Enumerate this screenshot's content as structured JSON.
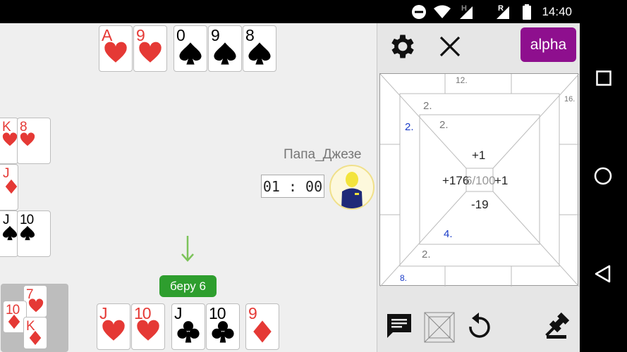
{
  "status_bar": {
    "time": "14:40",
    "icons": [
      "do-not-disturb-icon",
      "wifi-icon",
      "signal-h-icon",
      "signal-r-icon",
      "battery-icon"
    ]
  },
  "table": {
    "top_cards": [
      {
        "rank": "A",
        "suit": "hearts"
      },
      {
        "rank": "9",
        "suit": "hearts"
      },
      {
        "rank": "0",
        "suit": "spades"
      },
      {
        "rank": "9",
        "suit": "spades"
      },
      {
        "rank": "8",
        "suit": "spades"
      }
    ],
    "left_cards": [
      {
        "rank": "K",
        "suit": "hearts"
      },
      {
        "rank": "8",
        "suit": "hearts"
      },
      {
        "rank": "J",
        "suit": "diamonds"
      },
      {
        "rank": "J",
        "suit": "spades"
      },
      {
        "rank": "10",
        "suit": "spades"
      }
    ],
    "trick_cards": [
      {
        "rank": "7",
        "suit": "hearts"
      },
      {
        "rank": "10",
        "suit": "diamonds"
      },
      {
        "rank": "K",
        "suit": "diamonds"
      }
    ],
    "hand_cards": [
      {
        "rank": "J",
        "suit": "hearts"
      },
      {
        "rank": "10",
        "suit": "hearts"
      },
      {
        "rank": "J",
        "suit": "clubs"
      },
      {
        "rank": "10",
        "suit": "clubs"
      },
      {
        "rank": "9",
        "suit": "diamonds"
      }
    ],
    "player_name": "Папа_Джезе",
    "timer": "01 : 00",
    "bid_label": "беру 6",
    "colors": {
      "red_suit": "#e53935",
      "bid_green": "#2e9e2e",
      "arrow_green": "#7cc35a"
    }
  },
  "panel": {
    "alpha_label": "alpha",
    "alpha_color": "#8e0f8e",
    "score": {
      "top": "12.",
      "top_right": "16.",
      "outer_left_1": "2.",
      "outer_left_blue": "2.",
      "inner_top": "2.",
      "center_top": "+1",
      "center_left": "+176",
      "center_box": "6/100",
      "center_right": "+1",
      "center_bottom": "-19",
      "inner_bottom_blue": "4.",
      "lower_left": "2.",
      "bottom_left_blue": "8."
    },
    "bottom_icons": [
      "chat-icon",
      "board-icon",
      "undo-icon",
      "gavel-icon"
    ]
  },
  "navbar": {
    "icons": [
      "recents-icon",
      "home-icon",
      "back-icon"
    ]
  }
}
